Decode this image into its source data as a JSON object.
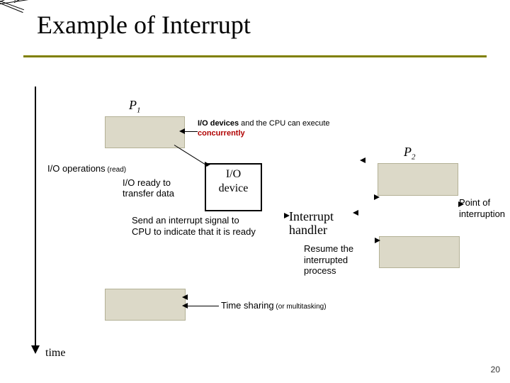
{
  "title": "Example of Interrupt",
  "labels": {
    "p1": "P",
    "p1_sub": "1",
    "p2": "P",
    "p2_sub": "2",
    "time": "time",
    "io_device_l1": "I/O",
    "io_device_l2": "device",
    "slidenum": "20"
  },
  "notes": {
    "concurrent_a": "I/O devices",
    "concurrent_b": " and the CPU can execute ",
    "concurrent_c": "concurrently",
    "io_ops": "I/O operations",
    "io_ops_paren": " (read)",
    "io_ready": "I/O ready to transfer data",
    "send_signal": "Send an interrupt signal to CPU to indicate that it is ready",
    "interrupt_handler": "Interrupt\nhandler",
    "resume": "Resume the interrupted process",
    "poi": "Point of interruption",
    "tshare": "Time sharing",
    "tshare_paren": " (or multitasking)"
  }
}
